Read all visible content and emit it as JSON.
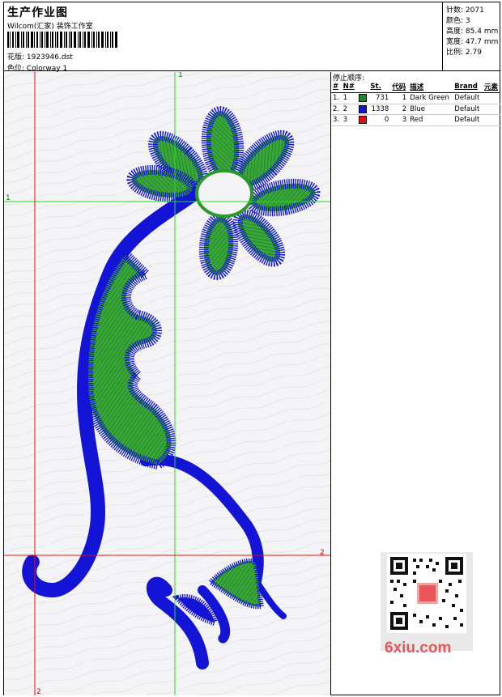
{
  "header": {
    "title": "生产作业图",
    "company": "Wilcom(汇家) 装饰工作室",
    "design_label": "花版:",
    "design_file": "1923946.dst",
    "colorway_label": "色位:",
    "colorway_name": "Colorway 1"
  },
  "stats": [
    {
      "label": "针数:",
      "value": "2071"
    },
    {
      "label": "颜色:",
      "value": "3"
    },
    {
      "label": "高度:",
      "value": "85.4 mm"
    },
    {
      "label": "宽度:",
      "value": "47.7 mm"
    },
    {
      "label": "比例:",
      "value": "2.79"
    }
  ],
  "stop_sequence": {
    "title": "停止顺序:",
    "columns": [
      "#",
      "N#",
      "St.",
      "代码",
      "描述",
      "Brand",
      "元素"
    ],
    "rows": [
      {
        "num": "1.",
        "n": "1",
        "color": "#1a8a1a",
        "st": "731",
        "code": "1",
        "desc": "Dark Green",
        "brand": "Default",
        "element": ""
      },
      {
        "num": "2.",
        "n": "2",
        "color": "#1414d6",
        "st": "1338",
        "code": "2",
        "desc": "Blue",
        "brand": "Default",
        "element": ""
      },
      {
        "num": "3.",
        "n": "3",
        "color": "#e01010",
        "st": "0",
        "code": "3",
        "desc": "Red",
        "brand": "Default",
        "element": ""
      }
    ]
  },
  "guides": {
    "v1": "1",
    "h1": "1",
    "v2": "2",
    "h2": "2"
  },
  "watermark": "6xiu.com",
  "colors": {
    "green": "#2a9a2a",
    "blue": "#1414d6",
    "red": "#e01010",
    "guide_green": "#20e020",
    "guide_red": "#e01010"
  }
}
